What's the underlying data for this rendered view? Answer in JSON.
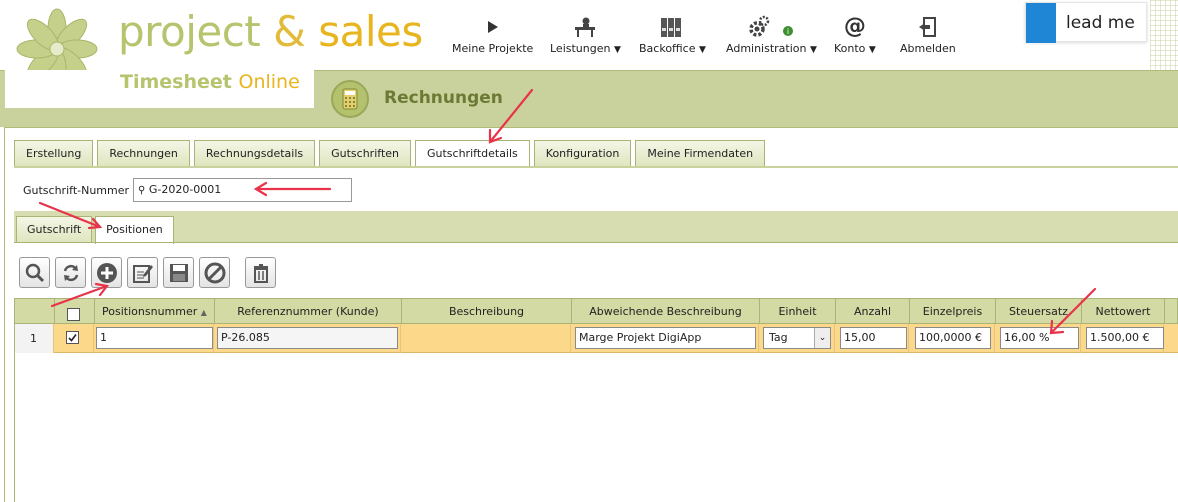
{
  "header": {
    "logo_title_part1": "project",
    "logo_title_amp": "&",
    "logo_title_part2": "sales",
    "logo_sub_part1": "Timesheet",
    "logo_sub_part2": "Online"
  },
  "nav": [
    {
      "label": "Meine Projekte",
      "icon": "play-icon",
      "caret": ""
    },
    {
      "label": "Leistungen",
      "icon": "desk-worker-icon",
      "caret": "▼"
    },
    {
      "label": "Backoffice",
      "icon": "binders-icon",
      "caret": "▼"
    },
    {
      "label": "Administration",
      "icon": "gears-icon",
      "caret": "▼"
    },
    {
      "label": "Konto",
      "icon": "at-icon",
      "caret": "▼"
    },
    {
      "label": "Abmelden",
      "icon": "logout-icon",
      "caret": ""
    }
  ],
  "leadme": {
    "label": "lead me"
  },
  "page": {
    "title": "Rechnungen"
  },
  "tabs": [
    "Erstellung",
    "Rechnungen",
    "Rechnungsdetails",
    "Gutschriften",
    "Gutschriftdetails",
    "Konfiguration",
    "Meine Firmendaten"
  ],
  "active_tab": "Gutschriftdetails",
  "gutschrift": {
    "label": "Gutschrift-Nummer",
    "value": "G-2020-0001"
  },
  "subtabs": [
    "Gutschrift",
    "Positionen"
  ],
  "active_subtab": "Positionen",
  "toolbar": [
    "search-icon",
    "refresh-icon",
    "add-icon",
    "edit-icon",
    "save-icon",
    "cancel-icon",
    "delete-icon"
  ],
  "table": {
    "headers": [
      "",
      "",
      "Positionsnummer",
      "Referenznummer (Kunde)",
      "Beschreibung",
      "Abweichende Beschreibung",
      "Einheit",
      "Anzahl",
      "Einzelpreis",
      "Steuersatz",
      "Nettowert"
    ],
    "rows": [
      {
        "rownum": "1",
        "checked": true,
        "positionsnummer": "1",
        "referenznummer": "P-26.085",
        "beschreibung": "",
        "abweichende_beschreibung": "Marge Projekt DigiApp",
        "einheit": "Tag",
        "anzahl": "15,00",
        "einzelpreis": "100,0000 €",
        "steuersatz": "16,00 %",
        "nettowert": "1.500,00 €"
      }
    ]
  },
  "colors": {
    "brand_green": "#b6c46d",
    "brand_yellow": "#e8b51f",
    "band": "#c9d29c",
    "row_highlight": "#fcd98a",
    "annotation_arrow": "#e8334a"
  }
}
